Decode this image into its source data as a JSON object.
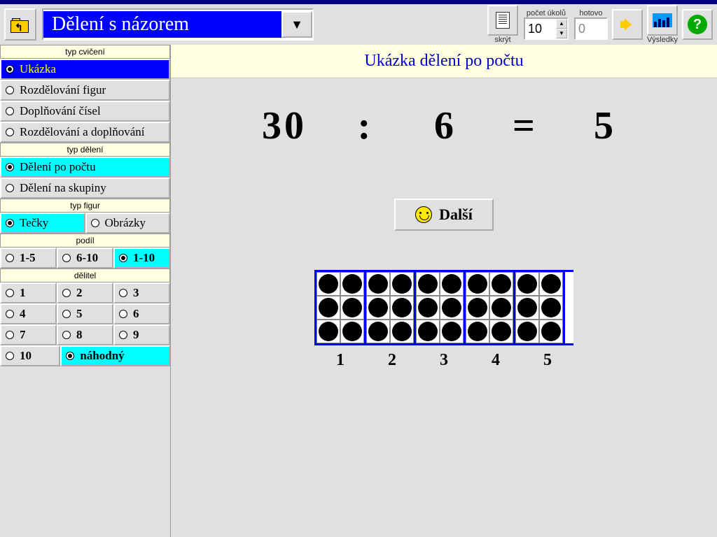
{
  "toolbar": {
    "title": "Dělení s názorem",
    "hide_label": "skrýt",
    "tasks_label": "počet úkolů",
    "tasks_value": "10",
    "done_label": "hotovo",
    "done_value": "0",
    "results_label": "Výsledky"
  },
  "sidebar": {
    "group1": {
      "header": "typ cvičení",
      "items": [
        "Ukázka",
        "Rozdělování figur",
        "Doplňování čísel",
        "Rozdělování a doplňování"
      ],
      "selected": 0
    },
    "group2": {
      "header": "typ dělení",
      "items": [
        "Dělení po počtu",
        "Dělení na skupiny"
      ],
      "selected": 0
    },
    "group3": {
      "header": "typ figur",
      "items": [
        "Tečky",
        "Obrázky"
      ],
      "selected": 0
    },
    "group4": {
      "header": "podíl",
      "items": [
        "1-5",
        "6-10",
        "1-10"
      ],
      "selected": 2
    },
    "group5": {
      "header": "dělitel",
      "items": [
        "1",
        "2",
        "3",
        "4",
        "5",
        "6",
        "7",
        "8",
        "9",
        "10",
        "náhodný"
      ],
      "selected": 10
    }
  },
  "main": {
    "banner": "Ukázka dělení po počtu",
    "eq": {
      "a": "30",
      "op": ":",
      "b": "6",
      "eq": "=",
      "c": "5"
    },
    "next": "Další",
    "groups": 5,
    "dots_per_group": 6,
    "labels": [
      "1",
      "2",
      "3",
      "4",
      "5"
    ]
  }
}
